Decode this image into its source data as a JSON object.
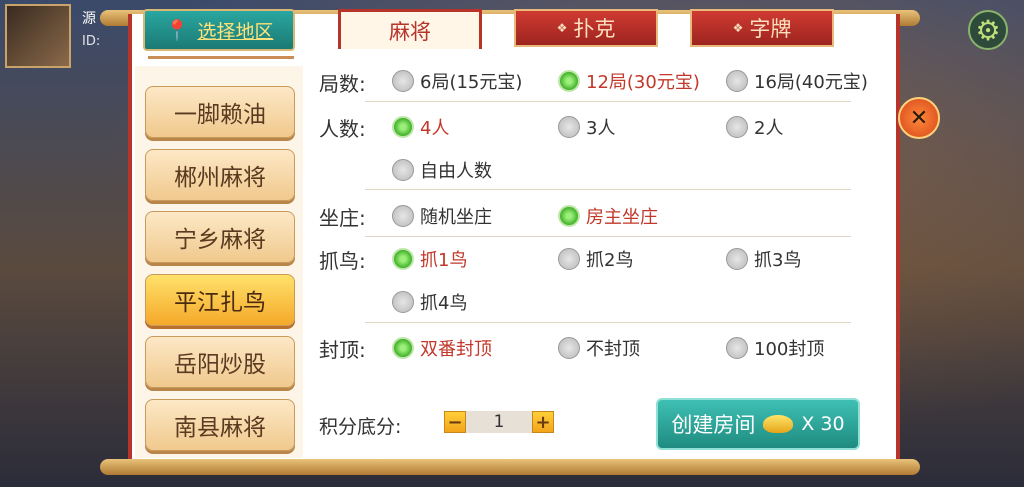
{
  "player": {
    "name": "源",
    "id": "ID:"
  },
  "location_button": "选择地区",
  "tabs": [
    "麻将",
    "扑克",
    "字牌"
  ],
  "regions": [
    "一脚赖油",
    "郴州麻将",
    "宁乡麻将",
    "平江扎鸟",
    "岳阳炒股",
    "南县麻将"
  ],
  "selected_region": "平江扎鸟",
  "rows": [
    {
      "label": "局数:",
      "options": [
        "6局(15元宝)",
        "12局(30元宝)",
        "16局(40元宝)"
      ],
      "selected": 1
    },
    {
      "label": "人数:",
      "options": [
        "4人",
        "3人",
        "2人",
        "自由人数"
      ],
      "selected": 0
    },
    {
      "label": "坐庄:",
      "options": [
        "随机坐庄",
        "房主坐庄"
      ],
      "selected": 1
    },
    {
      "label": "抓鸟:",
      "options": [
        "抓1鸟",
        "抓2鸟",
        "抓3鸟",
        "抓4鸟"
      ],
      "selected": 0
    },
    {
      "label": "封顶:",
      "options": [
        "双番封顶",
        "不封顶",
        "100封顶"
      ],
      "selected": 0
    }
  ],
  "score": {
    "label": "积分底分:",
    "value": "1",
    "minus": "−",
    "plus": "+"
  },
  "create_button": {
    "label": "创建房间",
    "cost": "X 30"
  },
  "icons": {
    "close": "close-icon",
    "settings": "gear-icon",
    "location": "location-pin-icon",
    "ingot": "ingot-icon"
  },
  "colors": {
    "accent_red": "#b6342a",
    "teal": "#1f8b80",
    "selected_text": "#c2382a"
  }
}
